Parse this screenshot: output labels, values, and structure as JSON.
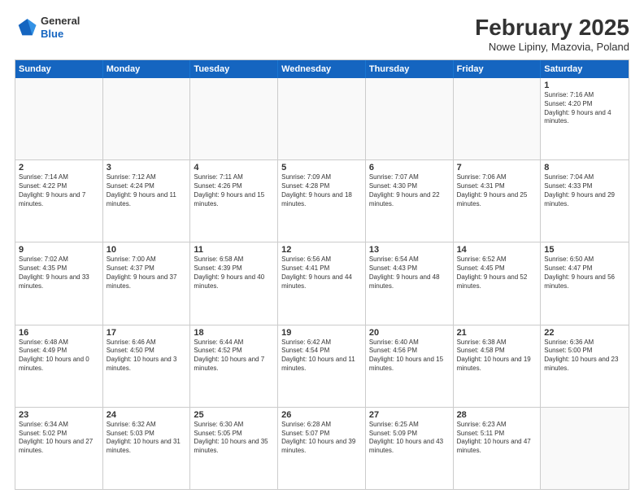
{
  "logo": {
    "general": "General",
    "blue": "Blue"
  },
  "header": {
    "title": "February 2025",
    "subtitle": "Nowe Lipiny, Mazovia, Poland"
  },
  "weekdays": [
    "Sunday",
    "Monday",
    "Tuesday",
    "Wednesday",
    "Thursday",
    "Friday",
    "Saturday"
  ],
  "weeks": [
    [
      {
        "day": "",
        "info": ""
      },
      {
        "day": "",
        "info": ""
      },
      {
        "day": "",
        "info": ""
      },
      {
        "day": "",
        "info": ""
      },
      {
        "day": "",
        "info": ""
      },
      {
        "day": "",
        "info": ""
      },
      {
        "day": "1",
        "info": "Sunrise: 7:16 AM\nSunset: 4:20 PM\nDaylight: 9 hours and 4 minutes."
      }
    ],
    [
      {
        "day": "2",
        "info": "Sunrise: 7:14 AM\nSunset: 4:22 PM\nDaylight: 9 hours and 7 minutes."
      },
      {
        "day": "3",
        "info": "Sunrise: 7:12 AM\nSunset: 4:24 PM\nDaylight: 9 hours and 11 minutes."
      },
      {
        "day": "4",
        "info": "Sunrise: 7:11 AM\nSunset: 4:26 PM\nDaylight: 9 hours and 15 minutes."
      },
      {
        "day": "5",
        "info": "Sunrise: 7:09 AM\nSunset: 4:28 PM\nDaylight: 9 hours and 18 minutes."
      },
      {
        "day": "6",
        "info": "Sunrise: 7:07 AM\nSunset: 4:30 PM\nDaylight: 9 hours and 22 minutes."
      },
      {
        "day": "7",
        "info": "Sunrise: 7:06 AM\nSunset: 4:31 PM\nDaylight: 9 hours and 25 minutes."
      },
      {
        "day": "8",
        "info": "Sunrise: 7:04 AM\nSunset: 4:33 PM\nDaylight: 9 hours and 29 minutes."
      }
    ],
    [
      {
        "day": "9",
        "info": "Sunrise: 7:02 AM\nSunset: 4:35 PM\nDaylight: 9 hours and 33 minutes."
      },
      {
        "day": "10",
        "info": "Sunrise: 7:00 AM\nSunset: 4:37 PM\nDaylight: 9 hours and 37 minutes."
      },
      {
        "day": "11",
        "info": "Sunrise: 6:58 AM\nSunset: 4:39 PM\nDaylight: 9 hours and 40 minutes."
      },
      {
        "day": "12",
        "info": "Sunrise: 6:56 AM\nSunset: 4:41 PM\nDaylight: 9 hours and 44 minutes."
      },
      {
        "day": "13",
        "info": "Sunrise: 6:54 AM\nSunset: 4:43 PM\nDaylight: 9 hours and 48 minutes."
      },
      {
        "day": "14",
        "info": "Sunrise: 6:52 AM\nSunset: 4:45 PM\nDaylight: 9 hours and 52 minutes."
      },
      {
        "day": "15",
        "info": "Sunrise: 6:50 AM\nSunset: 4:47 PM\nDaylight: 9 hours and 56 minutes."
      }
    ],
    [
      {
        "day": "16",
        "info": "Sunrise: 6:48 AM\nSunset: 4:49 PM\nDaylight: 10 hours and 0 minutes."
      },
      {
        "day": "17",
        "info": "Sunrise: 6:46 AM\nSunset: 4:50 PM\nDaylight: 10 hours and 3 minutes."
      },
      {
        "day": "18",
        "info": "Sunrise: 6:44 AM\nSunset: 4:52 PM\nDaylight: 10 hours and 7 minutes."
      },
      {
        "day": "19",
        "info": "Sunrise: 6:42 AM\nSunset: 4:54 PM\nDaylight: 10 hours and 11 minutes."
      },
      {
        "day": "20",
        "info": "Sunrise: 6:40 AM\nSunset: 4:56 PM\nDaylight: 10 hours and 15 minutes."
      },
      {
        "day": "21",
        "info": "Sunrise: 6:38 AM\nSunset: 4:58 PM\nDaylight: 10 hours and 19 minutes."
      },
      {
        "day": "22",
        "info": "Sunrise: 6:36 AM\nSunset: 5:00 PM\nDaylight: 10 hours and 23 minutes."
      }
    ],
    [
      {
        "day": "23",
        "info": "Sunrise: 6:34 AM\nSunset: 5:02 PM\nDaylight: 10 hours and 27 minutes."
      },
      {
        "day": "24",
        "info": "Sunrise: 6:32 AM\nSunset: 5:03 PM\nDaylight: 10 hours and 31 minutes."
      },
      {
        "day": "25",
        "info": "Sunrise: 6:30 AM\nSunset: 5:05 PM\nDaylight: 10 hours and 35 minutes."
      },
      {
        "day": "26",
        "info": "Sunrise: 6:28 AM\nSunset: 5:07 PM\nDaylight: 10 hours and 39 minutes."
      },
      {
        "day": "27",
        "info": "Sunrise: 6:25 AM\nSunset: 5:09 PM\nDaylight: 10 hours and 43 minutes."
      },
      {
        "day": "28",
        "info": "Sunrise: 6:23 AM\nSunset: 5:11 PM\nDaylight: 10 hours and 47 minutes."
      },
      {
        "day": "",
        "info": ""
      }
    ]
  ]
}
